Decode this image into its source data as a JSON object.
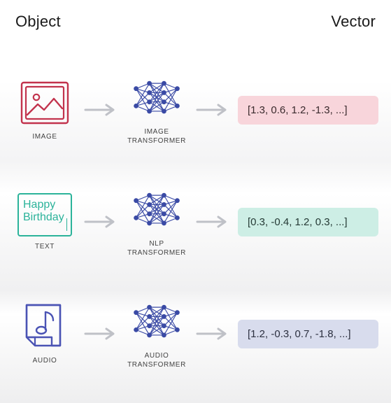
{
  "header": {
    "left": "Object",
    "right": "Vector"
  },
  "rows": [
    {
      "input_label": "IMAGE",
      "transformer_label": "IMAGE\nTRANSFORMER",
      "vector_text": "[1.3, 0.6, 1.2, -1.3, ...]",
      "vector_class": "vec-pink"
    },
    {
      "input_label": "TEXT",
      "text_sample": "Happy\nBirthday",
      "transformer_label": "NLP\nTRANSFORMER",
      "vector_text": "[0.3, -0.4, 1.2, 0.3, ...]",
      "vector_class": "vec-teal"
    },
    {
      "input_label": "AUDIO",
      "transformer_label": "AUDIO\nTRANSFORMER",
      "vector_text": "[1.2, -0.3, 0.7, -1.8, ...]",
      "vector_class": "vec-blue"
    }
  ],
  "colors": {
    "image_stroke": "#c2334d",
    "text_stroke": "#2bb39a",
    "audio_stroke": "#4a53b4",
    "nn_stroke": "#3a4aa5",
    "arrow_stroke": "#bfc1c7"
  }
}
